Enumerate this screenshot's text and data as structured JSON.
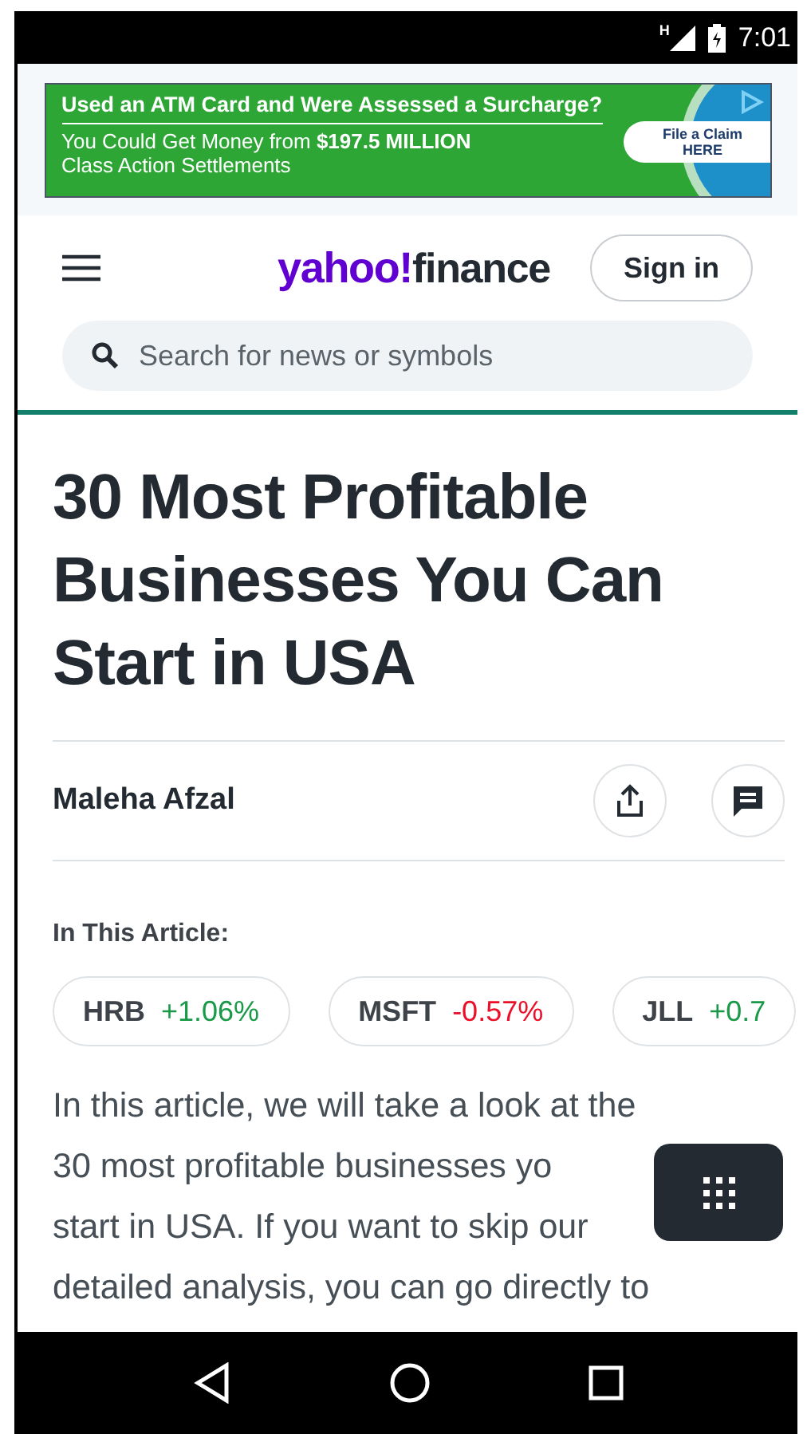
{
  "status_bar": {
    "network": "H",
    "time": "7:01"
  },
  "ad": {
    "headline": "Used an ATM Card and Were Assessed a Surcharge?",
    "body": "You Could Get Money from **$197.5 MILLION**",
    "body_2": "Class Action Settlements",
    "cta": "File a Claim HERE"
  },
  "header": {
    "logo_main": "yahoo!",
    "logo_sub": "finance",
    "sign_in": "Sign in",
    "search": {
      "placeholder": "Search for news or symbols"
    }
  },
  "article": {
    "title": "30 Most Profitable Businesses You Can Start in USA",
    "author": "Maleha Afzal",
    "tickers_label": "In This Article:",
    "tickers": [
      {
        "symbol": "HRB",
        "change": "+1.06%",
        "color": "#1a9a49"
      },
      {
        "symbol": "MSFT",
        "change": "-0.57%",
        "color": "#eb0f29"
      },
      {
        "symbol": "JLL",
        "change": "+0.7",
        "color": "#1a9a49"
      }
    ],
    "paragraph_lines": [
      "In this article, we will take a look at the",
      "30 most profitable businesses yo",
      "start in USA. If you want to skip our",
      "detailed analysis, you can go directly to"
    ]
  }
}
